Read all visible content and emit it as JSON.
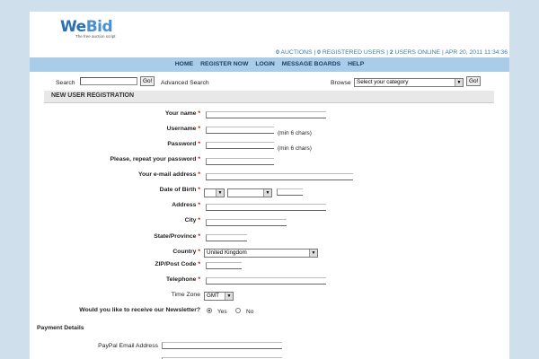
{
  "logo": {
    "brand_a": "We",
    "brand_b": "Bid",
    "tagline": "The free auction script"
  },
  "stats": {
    "auctions_count": "0",
    "auctions_label": "AUCTIONS",
    "users_count": "0",
    "users_label": "REGISTERED USERS",
    "online_count": "2",
    "online_label": "USERS ONLINE",
    "datetime": "APR 20, 2011 11:34:36"
  },
  "nav": [
    "HOME",
    "REGISTER NOW",
    "LOGIN",
    "MESSAGE BOARDS",
    "HELP"
  ],
  "search": {
    "label": "Search",
    "go": "Go!",
    "advanced": "Advanced Search",
    "browse_label": "Browse",
    "category_value": "Select your category",
    "go2": "Go!"
  },
  "section_title": "NEW USER REGISTRATION",
  "form": {
    "name": "Your name",
    "username": "Username",
    "password": "Password",
    "repeat_password": "Please, repeat your password",
    "email": "Your e-mail address",
    "dob": "Date of Birth",
    "address": "Address",
    "city": "City",
    "state": "State/Province",
    "country": "Country",
    "country_value": "United Kingdom",
    "zip": "ZIP/Post Code",
    "telephone": "Telephone",
    "timezone": "Time Zone",
    "timezone_value": "GMT",
    "newsletter": "Would you like to receive our Newsletter?",
    "yes": "Yes",
    "no": "No",
    "min_chars": "(min 6 chars)",
    "required_mark": "*"
  },
  "payment": {
    "title": "Payment Details",
    "paypal": "PayPal Email Address"
  },
  "icons": {
    "dropdown": "dropdown-arrow-icon"
  }
}
